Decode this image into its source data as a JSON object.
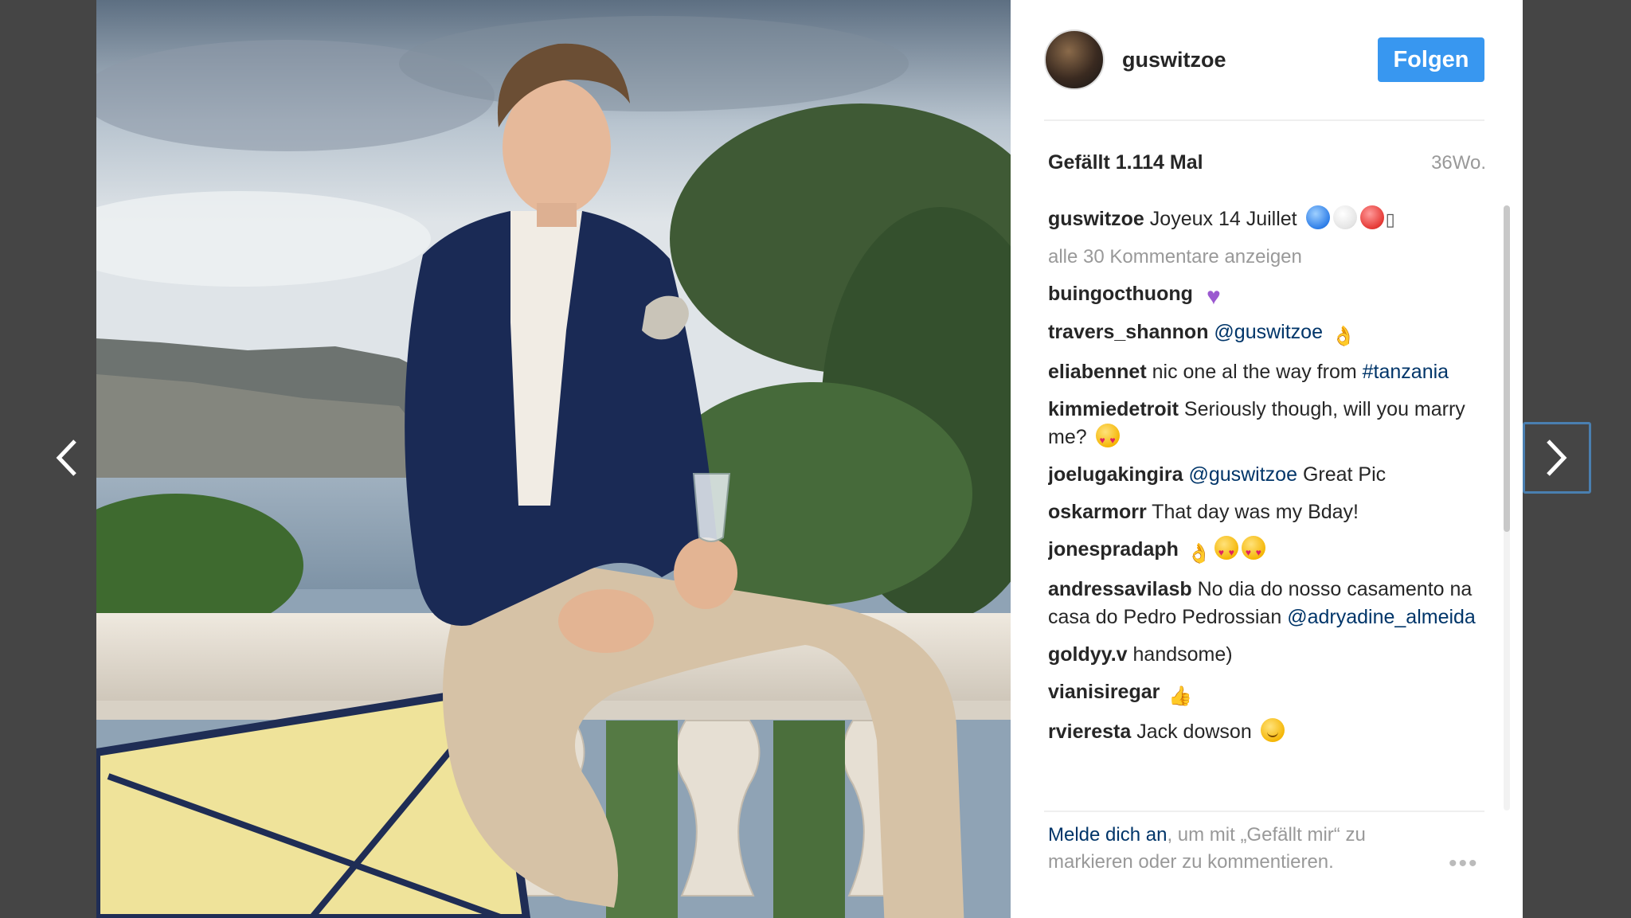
{
  "post": {
    "username": "guswitzoe",
    "follow_label": "Folgen",
    "likes": "Gefällt 1.114 Mal",
    "age": "36Wo.",
    "caption_user": "guswitzoe",
    "caption_text": "Joyeux 14 Juillet",
    "caption_box_glyph": "▯",
    "view_all_comments": "alle 30 Kommentare anzeigen"
  },
  "comments": [
    {
      "user": "buingocthuong",
      "text": "",
      "mention": "",
      "emojis": [
        "purple-heart"
      ]
    },
    {
      "user": "travers_shannon",
      "text": "",
      "mention": "@guswitzoe",
      "emojis": [
        "hand"
      ]
    },
    {
      "user": "eliabennet",
      "text": "nic one al the way from",
      "mention": "#tanzania",
      "emojis": []
    },
    {
      "user": "kimmiedetroit",
      "text": "Seriously though, will you marry me?",
      "mention": "",
      "emojis": [
        "heart-eyes"
      ]
    },
    {
      "user": "joelugakingira",
      "text": "",
      "mention": "@guswitzoe",
      "after": "Great Pic",
      "emojis": []
    },
    {
      "user": "oskarmorr",
      "text": "That day was my Bday!",
      "mention": "",
      "emojis": []
    },
    {
      "user": "jonespradaph",
      "text": "",
      "mention": "",
      "emojis": [
        "hand",
        "heart-eyes",
        "heart-eyes"
      ]
    },
    {
      "user": "andressavilasb",
      "text": "No dia do nosso casamento na casa do Pedro Pedrossian",
      "mention": "@adryadine_almeida",
      "emojis": []
    },
    {
      "user": "goldyy.v",
      "text": "handsome)",
      "mention": "",
      "emojis": []
    },
    {
      "user": "vianisiregar",
      "text": "",
      "mention": "",
      "emojis": [
        "thumbs"
      ]
    },
    {
      "user": "rvieresta",
      "text": "Jack dowson",
      "mention": "",
      "emojis": [
        "smile"
      ]
    }
  ],
  "footer": {
    "login_link": "Melde dich an",
    "rest": ", um mit „Gefällt mir“ zu markieren oder zu kommentieren.",
    "more": "•••"
  },
  "icons": {
    "prev": "chevron-left-icon",
    "next": "chevron-right-icon"
  },
  "colors": {
    "follow_button": "#3897f0",
    "link": "#003569",
    "muted": "#999999",
    "backdrop": "#454545"
  }
}
